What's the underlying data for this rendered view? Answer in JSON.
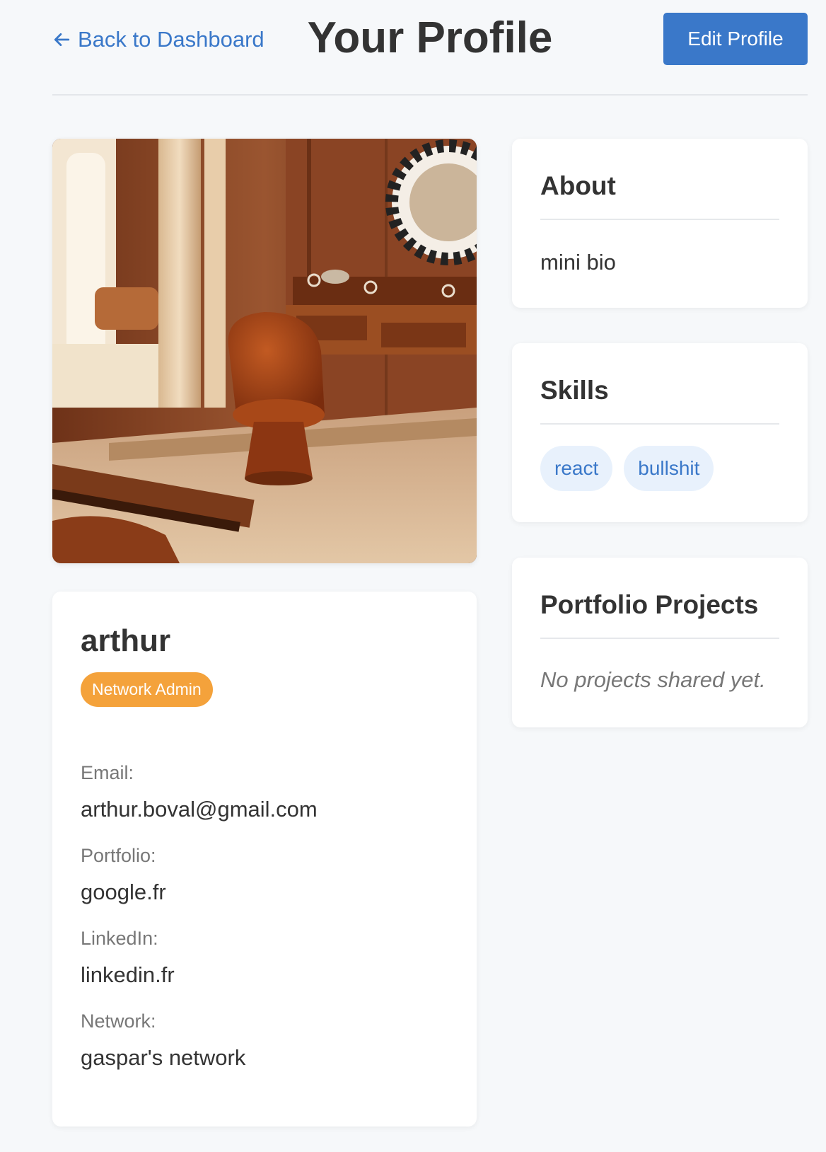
{
  "header": {
    "back_label": "Back to Dashboard",
    "title": "Your Profile",
    "edit_label": "Edit Profile"
  },
  "profile": {
    "name": "arthur",
    "role": "Network Admin",
    "fields": {
      "email_label": "Email:",
      "email": "arthur.boval@gmail.com",
      "portfolio_label": "Portfolio:",
      "portfolio": "google.fr",
      "linkedin_label": "LinkedIn:",
      "linkedin": "linkedin.fr",
      "network_label": "Network:",
      "network": "gaspar's network"
    }
  },
  "about": {
    "title": "About",
    "bio": "mini bio"
  },
  "skills": {
    "title": "Skills",
    "items": [
      "react",
      "bullshit"
    ]
  },
  "portfolio_projects": {
    "title": "Portfolio Projects",
    "empty": "No projects shared yet."
  },
  "colors": {
    "accent": "#3a78c9",
    "badge": "#f4a23b",
    "background": "#f6f8fa"
  },
  "icons": {
    "back": "arrow-left-icon"
  }
}
